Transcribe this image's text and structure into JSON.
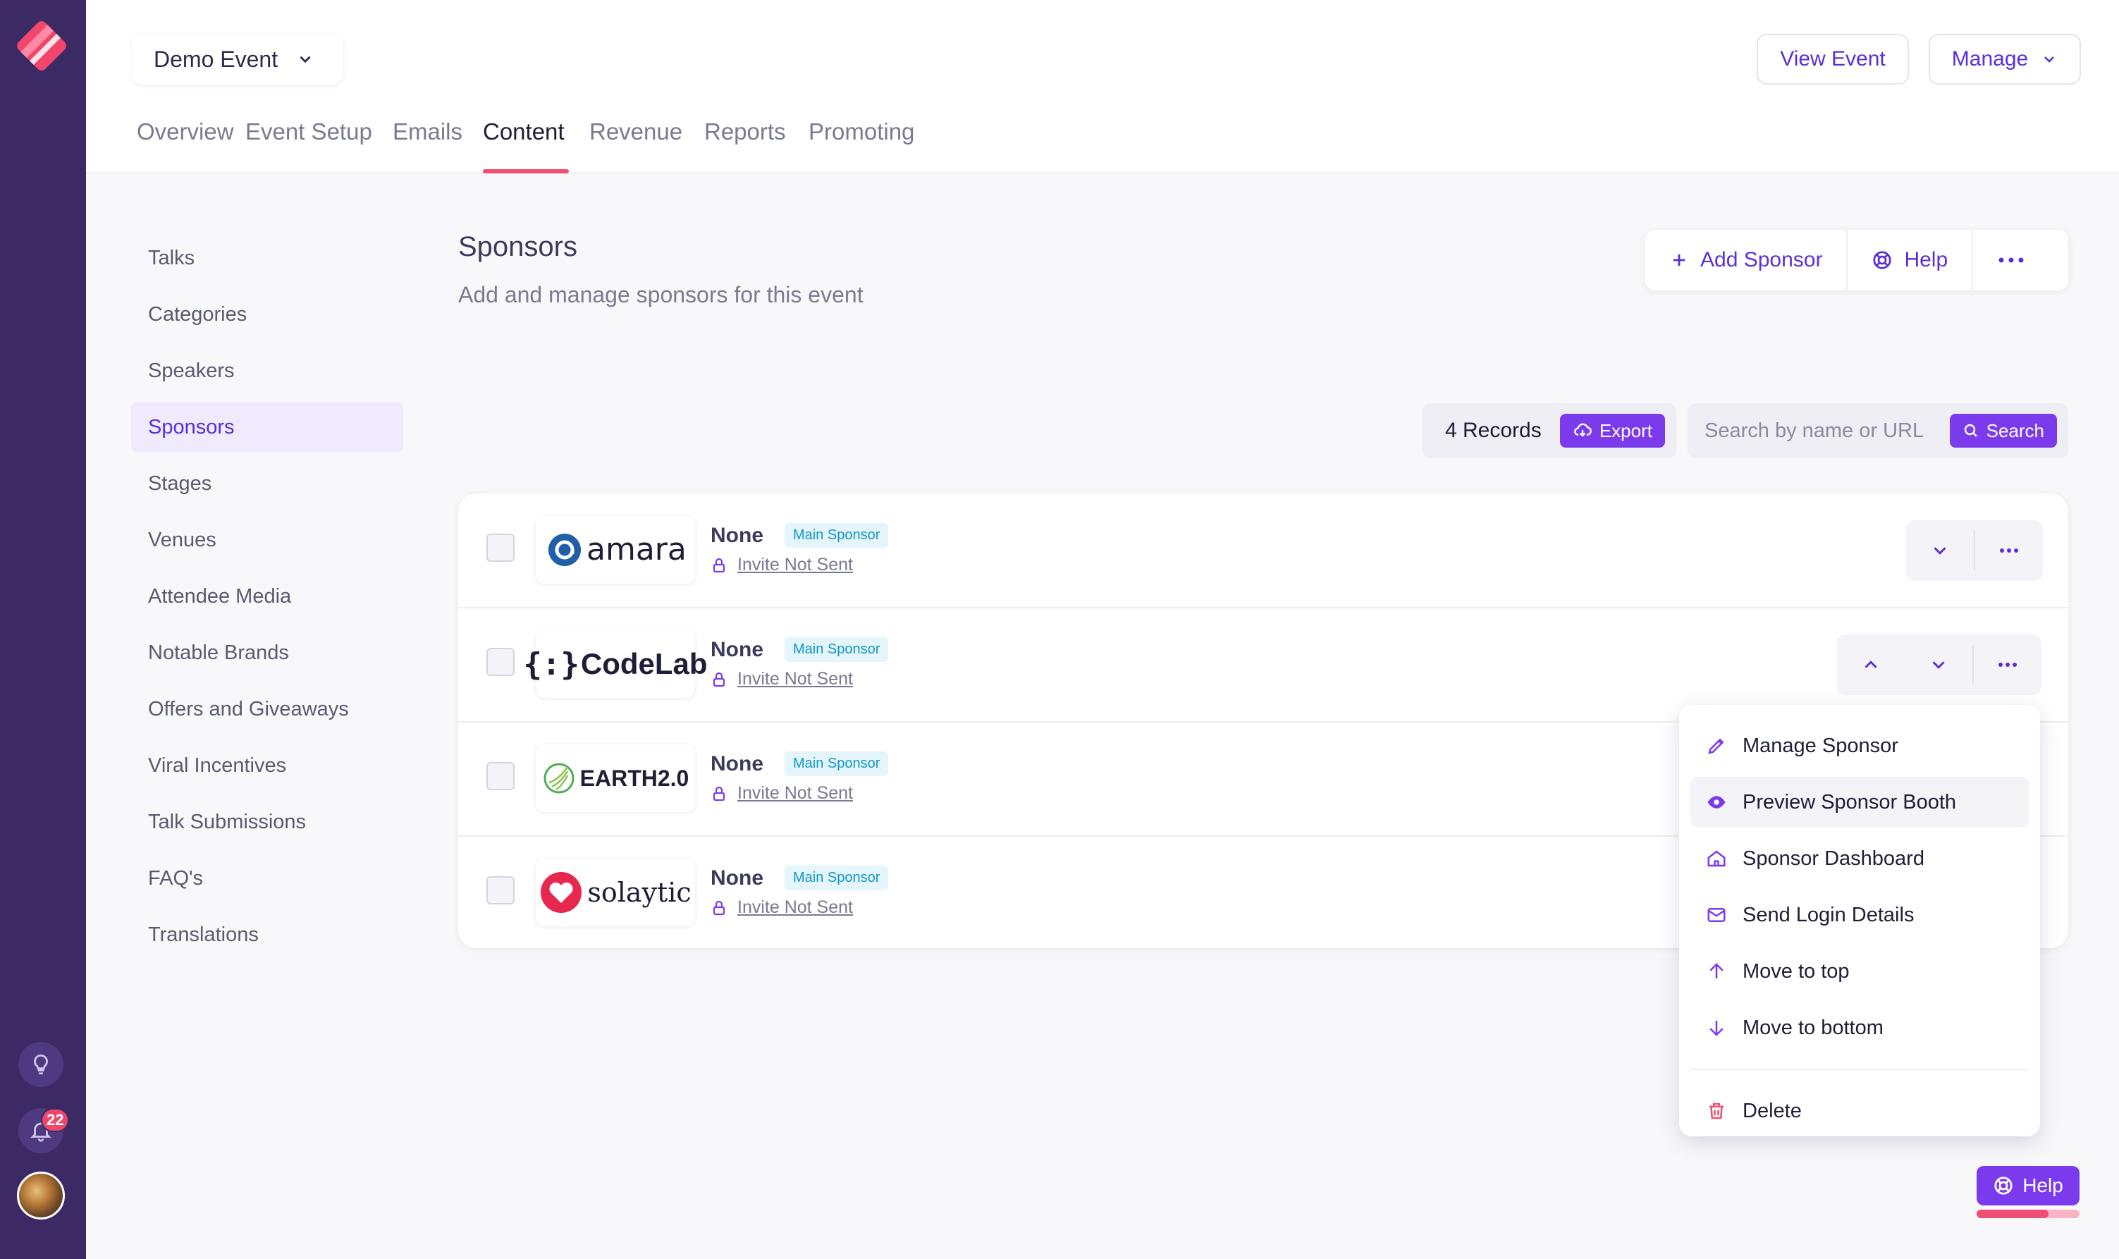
{
  "app": {
    "event_name": "Demo Event",
    "view_event_label": "View Event",
    "manage_label": "Manage",
    "notification_count": "22"
  },
  "tabs": [
    {
      "label": "Overview"
    },
    {
      "label": "Event Setup"
    },
    {
      "label": "Emails"
    },
    {
      "label": "Content"
    },
    {
      "label": "Revenue"
    },
    {
      "label": "Reports"
    },
    {
      "label": "Promoting"
    }
  ],
  "active_tab": "Content",
  "sidebar": {
    "items": [
      {
        "label": "Talks"
      },
      {
        "label": "Categories"
      },
      {
        "label": "Speakers"
      },
      {
        "label": "Sponsors"
      },
      {
        "label": "Stages"
      },
      {
        "label": "Venues"
      },
      {
        "label": "Attendee Media"
      },
      {
        "label": "Notable Brands"
      },
      {
        "label": "Offers and Giveaways"
      },
      {
        "label": "Viral Incentives"
      },
      {
        "label": "Talk Submissions"
      },
      {
        "label": "FAQ's"
      },
      {
        "label": "Translations"
      }
    ],
    "active": "Sponsors"
  },
  "page": {
    "title": "Sponsors",
    "subtitle": "Add and manage sponsors for this event",
    "add_label": "Add Sponsor",
    "help_label": "Help"
  },
  "records": {
    "count_label": "4 Records",
    "export_label": "Export"
  },
  "search": {
    "placeholder": "Search by name or URL",
    "button_label": "Search"
  },
  "sponsors": [
    {
      "logo_text": "amara",
      "level": "None",
      "tag": "Main Sponsor",
      "invite": "Invite Not Sent"
    },
    {
      "logo_text": "CodeLab",
      "level": "None",
      "tag": "Main Sponsor",
      "invite": "Invite Not Sent"
    },
    {
      "logo_text": "EARTH2.0",
      "level": "None",
      "tag": "Main Sponsor",
      "invite": "Invite Not Sent"
    },
    {
      "logo_text": "solaytic",
      "level": "None",
      "tag": "Main Sponsor",
      "invite": "Invite Not Sent"
    }
  ],
  "menu": {
    "items": [
      {
        "label": "Manage Sponsor",
        "icon": "pencil-icon"
      },
      {
        "label": "Preview Sponsor Booth",
        "icon": "eye-icon"
      },
      {
        "label": "Sponsor Dashboard",
        "icon": "home-icon"
      },
      {
        "label": "Send Login Details",
        "icon": "mail-icon"
      },
      {
        "label": "Move to top",
        "icon": "arrow-up-icon"
      },
      {
        "label": "Move to bottom",
        "icon": "arrow-down-icon"
      }
    ],
    "delete_label": "Delete"
  },
  "floating_help": {
    "label": "Help",
    "progress": 0.7
  },
  "colors": {
    "rail": "#3b2a63",
    "accent": "#7c3aed",
    "accent_text": "#5b2fd6",
    "tab_underline": "#ef4f72",
    "tag_text": "#1296c6",
    "danger": "#ef4f72"
  }
}
